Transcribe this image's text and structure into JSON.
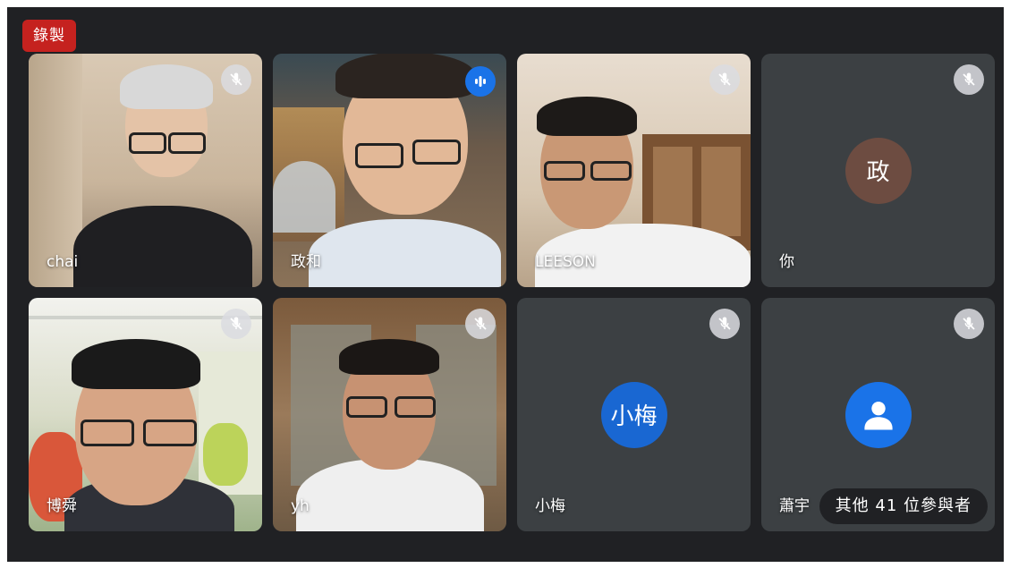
{
  "recording_badge": "錄製",
  "participants": [
    {
      "name": "chai",
      "status": "muted"
    },
    {
      "name": "政和",
      "status": "speaking"
    },
    {
      "name": "LEESON",
      "status": "muted"
    },
    {
      "name": "你",
      "status": "muted",
      "avatar_text": "政",
      "avatar_color": "#6d4c41"
    },
    {
      "name": "博舜",
      "status": "muted"
    },
    {
      "name": "yh",
      "status": "muted"
    },
    {
      "name": "小梅",
      "status": "muted",
      "avatar_text": "小梅",
      "avatar_color": "#1967d2"
    },
    {
      "name": "蕭宇",
      "status": "muted",
      "avatar_icon": "person-icon",
      "avatar_color": "#1a73e8"
    }
  ],
  "others_pill": "其他 41 位參與者",
  "colors": {
    "background": "#202124",
    "tile": "#3c4043",
    "record": "#c5221f",
    "speaking": "#1a73e8"
  }
}
